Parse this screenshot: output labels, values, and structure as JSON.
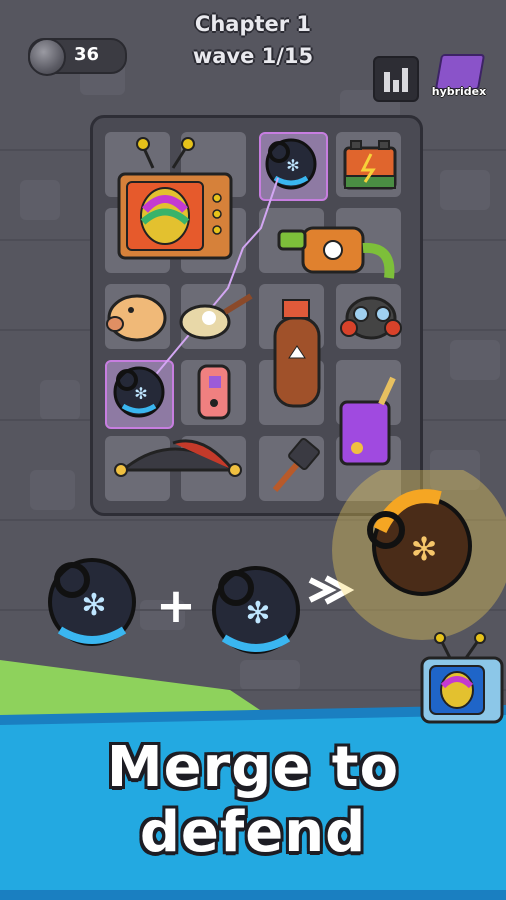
{
  "hud": {
    "coin_count": "36",
    "coin_icon": "gray-coin",
    "chapter_label": "Chapter 1",
    "wave_label": "wave 1/15",
    "stats_icon": "bar-chart",
    "hybridex_label": "hybridex",
    "hybridex_icon": "purple-book"
  },
  "board": {
    "grid_cols": 4,
    "grid_rows": 5,
    "items": [
      "retro-tv-with-rainbow-egg",
      "freeze-grenade",
      "battery",
      "poison-bottle",
      "piggy-bank",
      "frying-pan-with-egg",
      "fire-extinguisher",
      "gas-mask",
      "freeze-grenade",
      "game-controller",
      "purple-fuel-can",
      "jester-hat",
      "spatula"
    ],
    "merge_link": "lightning-link"
  },
  "merge_demo": {
    "input_1": "freeze-grenade",
    "operator": "+",
    "input_2": "freeze-grenade",
    "arrow_icon": "double-chevron-right",
    "result": "gold-grenade"
  },
  "promo": {
    "line_1": "Merge to",
    "line_2": "defend",
    "corner_icon": "retro-tv"
  },
  "colors": {
    "wall": "#56565f",
    "board": "#4a4a53",
    "cell": "#6c6c76",
    "banner": "#23a9e1",
    "banner_dark": "#1a7fc1",
    "grass": "#8ed25c",
    "highlight": "#c77ee0",
    "gold": "#f5a623"
  }
}
